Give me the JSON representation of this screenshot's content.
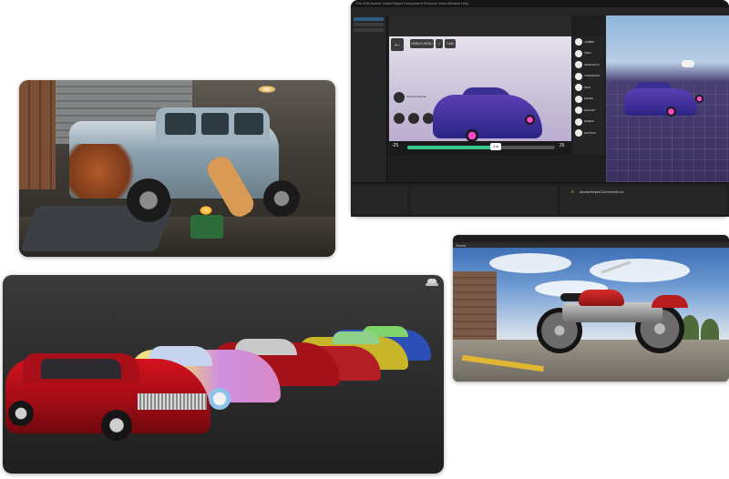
{
  "colors": {
    "unity_bg": "#1e1e1e",
    "accent_green": "#39c98f",
    "car_purple": "#3a2f92",
    "rim_pink": "#ff47c9",
    "lowrider_red": "#b3111b",
    "bike_red": "#d92b2b"
  },
  "editor": {
    "menubar": "File  Edit  Assets  GameObject  Component  Services  Jobs  Window  Help",
    "back_icon": "back-arrow-icon",
    "top_buttons": [
      "DEBUG MENU",
      "",
      "CAM"
    ],
    "side_buttons": [
      "SCALE GAUGE",
      "",
      ""
    ],
    "slider": {
      "min_label": "-25",
      "max_label": "25",
      "value_label": "5.00",
      "value": 5,
      "min": -25,
      "max": 25
    },
    "menu": [
      {
        "label": "CAMBER",
        "icon": "camber-icon",
        "active": true
      },
      {
        "label": "TIRES",
        "icon": "tire-icon",
        "active": false
      },
      {
        "label": "HEADLIGHTS",
        "icon": "headlight-icon",
        "active": false
      },
      {
        "label": "SUSPENSION",
        "icon": "suspension-icon",
        "active": false
      },
      {
        "label": "PAINT",
        "icon": "paint-icon",
        "active": false
      },
      {
        "label": "ENGINE",
        "icon": "engine-icon",
        "active": false
      },
      {
        "label": "EXHAUST",
        "icon": "exhaust-icon",
        "active": false
      },
      {
        "label": "WHEELS",
        "icon": "wheel-icon",
        "active": false
      },
      {
        "label": "SETTINGS",
        "icon": "settings-icon",
        "active": false
      }
    ],
    "warning_text": "Assets/Scripts/CarController.cs"
  },
  "bike_editor": {
    "tab": "Scene"
  },
  "cars_view": {
    "icon": "hat-icon"
  }
}
